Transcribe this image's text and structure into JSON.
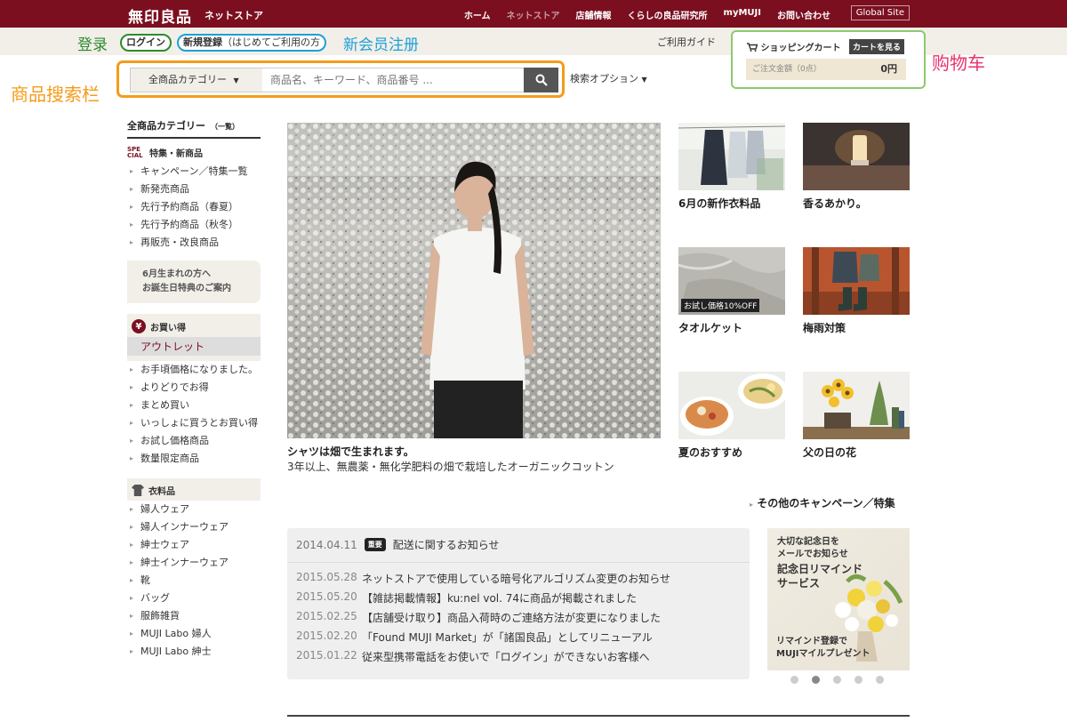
{
  "brand": {
    "logo": "無印良品",
    "subtitle": "ネットストア"
  },
  "topnav": [
    "ホーム",
    "ネットストア",
    "店舗情報",
    "くらしの良品研究所",
    "myMUJI",
    "お問い合わせ"
  ],
  "global_site": "Global Site",
  "annotations": {
    "login": "登录",
    "register": "新会员注册",
    "cart": "购物车",
    "search": "商品搜索栏"
  },
  "login_label": "ログイン",
  "register": {
    "label": "新規登録",
    "note": "（はじめてご利用の方"
  },
  "guide_label": "ご利用ガイド",
  "cart": {
    "title": "ショッピングカート",
    "view_label": "カートを見る",
    "total_label": "ご注文金額（0点）",
    "amount": "0円"
  },
  "search": {
    "category": "全商品カテゴリー",
    "placeholder": "商品名、キーワード、商品番号 ...",
    "options_label": "検索オプション"
  },
  "sidebar": {
    "title": "全商品カテゴリー",
    "title_note": "（一覧）",
    "special": {
      "icon_text": "SPE CIAL",
      "title": "特集・新商品",
      "items": [
        "キャンペーン／特集一覧",
        "新発売商品",
        "先行予約商品（春夏）",
        "先行予約商品（秋冬）",
        "再販売・改良商品"
      ]
    },
    "birthday": {
      "line1": "6月生まれの方へ",
      "line2": "お誕生日特典のご案内"
    },
    "deals": {
      "icon_text": "¥",
      "title": "お買い得",
      "highlight": "アウトレット",
      "items": [
        "お手頃価格になりました。",
        "よりどりでお得",
        "まとめ買い",
        "いっしょに買うとお買い得",
        "お試し価格商品",
        "数量限定商品"
      ]
    },
    "apparel": {
      "title": "衣料品",
      "items": [
        "婦人ウェア",
        "婦人インナーウェア",
        "紳士ウェア",
        "紳士インナーウェア",
        "靴",
        "バッグ",
        "服飾雑貨",
        "MUJI Labo 婦人",
        "MUJI Labo 紳士"
      ]
    }
  },
  "hero": {
    "caption": "シャツは畑で生まれます。",
    "sub": "3年以上、無農薬・無化学肥料の畑で栽培したオーガニックコットン"
  },
  "tiles": [
    {
      "caption": "6月の新作衣料品"
    },
    {
      "caption": "香るあかり。"
    },
    {
      "caption": "タオルケット",
      "badge": "お試し価格10%OFF"
    },
    {
      "caption": "梅雨対策"
    },
    {
      "caption": "夏のおすすめ"
    },
    {
      "caption": "父の日の花"
    }
  ],
  "more_link": "その他のキャンペーン／特集",
  "news": {
    "top": {
      "date": "2014.04.11",
      "tag": "重要",
      "text": "配送に関するお知らせ"
    },
    "items": [
      {
        "date": "2015.05.28",
        "text": "ネットストアで使用している暗号化アルゴリズム変更のお知らせ"
      },
      {
        "date": "2015.05.20",
        "text": "【雑誌掲載情報】ku:nel vol. 74に商品が掲載されました"
      },
      {
        "date": "2015.02.25",
        "text": "【店舗受け取り】商品入荷時のご連絡方法が変更になりました"
      },
      {
        "date": "2015.02.20",
        "text": "「Found MUJI Market」が「諸国良品」としてリニューアル"
      },
      {
        "date": "2015.01.22",
        "text": "従来型携帯電話をお使いで「ログイン」ができないお客様へ"
      }
    ]
  },
  "banner": {
    "line1": "大切な記念日を",
    "line2": "メールでお知らせ",
    "line3": "記念日リマインド",
    "line4": "サービス",
    "line5": "リマインド登録で",
    "line6": "MUJIマイルプレゼント"
  },
  "carousel": {
    "count": 5,
    "active": 2
  }
}
